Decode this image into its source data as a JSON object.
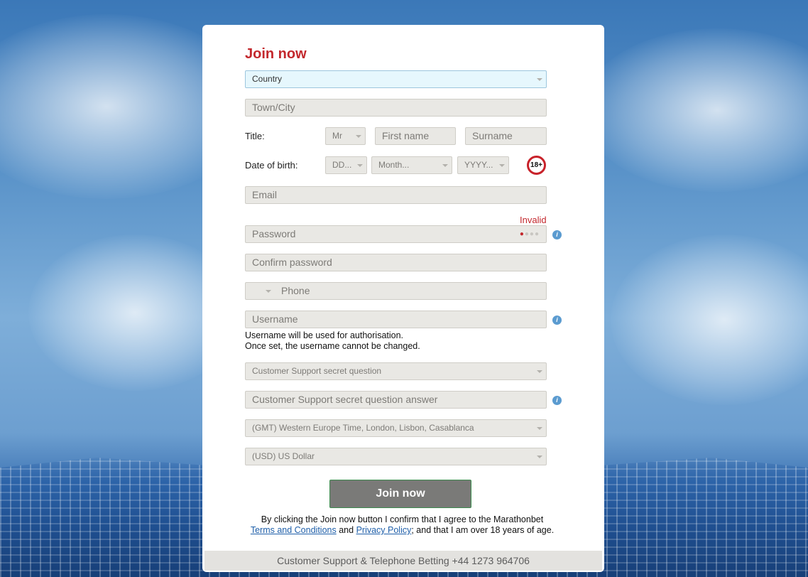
{
  "form": {
    "title": "Join now",
    "country_placeholder": "Country",
    "town_placeholder": "Town/City",
    "title_label": "Title:",
    "title_value": "Mr",
    "first_name_placeholder": "First name",
    "surname_placeholder": "Surname",
    "dob_label": "Date of birth:",
    "dob_day": "DD...",
    "dob_month": "Month...",
    "dob_year": "YYYY...",
    "age_badge": "18+",
    "email_placeholder": "Email",
    "password_status": "Invalid",
    "password_placeholder": "Password",
    "password_strength": "●●●●",
    "confirm_password_placeholder": "Confirm password",
    "phone_placeholder": "Phone",
    "username_placeholder": "Username",
    "username_hint_line1": "Username will be used for authorisation.",
    "username_hint_line2": "Once set, the username cannot be changed.",
    "secret_question": "Customer Support secret question",
    "secret_answer_placeholder": "Customer Support secret question answer",
    "timezone": "(GMT) Western Europe Time, London, Lisbon, Casablanca",
    "currency": "(USD) US Dollar",
    "submit_label": "Join now",
    "terms_text_1": "By clicking the Join now button I confirm that I agree to the Marathonbet",
    "terms_link": "Terms and Conditions",
    "terms_and": "and",
    "privacy_link": "Privacy Policy",
    "terms_text_2": "; and that I am over 18 years of age.",
    "footer_text": "Customer Support & Telephone Betting  +44 1273 964706"
  },
  "icons": {
    "info": "info-icon",
    "dropdown": "chevron-down-icon",
    "age": "18-plus-icon"
  },
  "colors": {
    "accent": "#c3282d",
    "link": "#1f5fa9",
    "info": "#5b9bd0",
    "button": "#7a7a78"
  }
}
